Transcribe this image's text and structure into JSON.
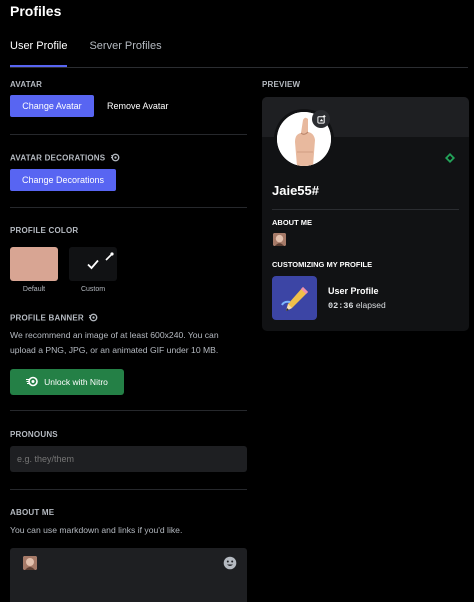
{
  "header": {
    "title": "Profiles"
  },
  "tabs": [
    {
      "label": "User Profile",
      "active": true
    },
    {
      "label": "Server Profiles",
      "active": false
    }
  ],
  "avatar": {
    "label": "AVATAR",
    "change_button": "Change Avatar",
    "remove_button": "Remove Avatar"
  },
  "avatar_decorations": {
    "label": "AVATAR DECORATIONS",
    "change_button": "Change Decorations"
  },
  "profile_color": {
    "label": "PROFILE COLOR",
    "default_caption": "Default",
    "custom_caption": "Custom",
    "default_color": "#d8a593",
    "custom_color": "#111214"
  },
  "profile_banner": {
    "label": "PROFILE BANNER",
    "description_line1": "We recommend an image of at least 600x240. You can",
    "description_line2": "upload a PNG, JPG, or an animated GIF under 10 MB.",
    "unlock_button": "Unlock with Nitro"
  },
  "pronouns": {
    "label": "PRONOUNS",
    "placeholder": "e.g. they/them",
    "value": ""
  },
  "about_me": {
    "label": "ABOUT ME",
    "hint": "You can use markdown and links if you'd like."
  },
  "preview": {
    "label": "PREVIEW",
    "username": "Jaie55#",
    "about_me_label": "ABOUT ME",
    "activity_label": "CUSTOMIZING MY PROFILE",
    "activity_title": "User Profile",
    "activity_time": "02:36",
    "activity_suffix": "elapsed"
  },
  "colors": {
    "accent": "#5865f2",
    "nitro_green": "#248046",
    "background": "#000000",
    "card": "#111214"
  }
}
